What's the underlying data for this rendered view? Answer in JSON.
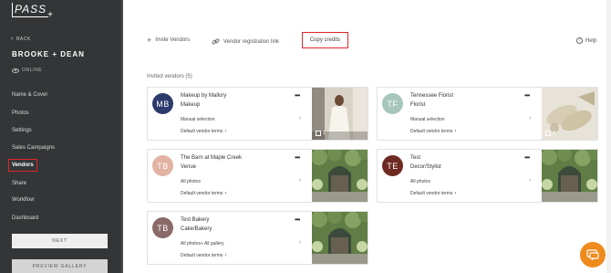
{
  "sidebar": {
    "logo": "PASS",
    "back": "BACK",
    "gallery_title": "BROOKE + DEAN",
    "status": "ONLINE",
    "items": [
      {
        "label": "Name & Cover"
      },
      {
        "label": "Photos"
      },
      {
        "label": "Settings"
      },
      {
        "label": "Sales Campaigns"
      },
      {
        "label": "Vendors"
      },
      {
        "label": "Share"
      },
      {
        "label": "Workflow"
      },
      {
        "label": "Dashboard"
      }
    ],
    "next_label": "NEXT",
    "preview_label": "PREVIEW GALLERY"
  },
  "toolbar": {
    "invite_label": "Invite Vendors",
    "registration_label": "Vendor registration link",
    "copy_credits_label": "Copy credits",
    "help_label": "Help"
  },
  "section_title": "Invited vendors (5)",
  "vendors": [
    {
      "initials": "MB",
      "name": "Makeup by Mallory",
      "type": "Makeup",
      "selection": "Manual selection",
      "terms": "Default vendor terms",
      "count": "1",
      "avatar_color": "#2d3a6b"
    },
    {
      "initials": "TF",
      "name": "Tennessee Florist",
      "type": "Florist",
      "selection": "Manual selection",
      "terms": "Default vendor terms",
      "count": "4",
      "avatar_color": "#a8c7bc"
    },
    {
      "initials": "TB",
      "name": "The Barn at Maple Creek",
      "type": "Venue",
      "selection": "All photos",
      "terms": "Default vendor terms",
      "count": "",
      "avatar_color": "#e2b2a2"
    },
    {
      "initials": "TE",
      "name": "Test",
      "type": "Decor/Stylist",
      "selection": "All photos",
      "terms": "Default vendor terms",
      "count": "",
      "avatar_color": "#6e2a22"
    },
    {
      "initials": "TB",
      "name": "Test Bakery",
      "type": "Cake/Bakery",
      "selection": "All photos+ All gallery",
      "terms": "Default vendor terms",
      "count": "",
      "avatar_color": "#8a6a68"
    }
  ],
  "colors": {
    "sidebar_bg": "#333536",
    "highlight": "#e0262b",
    "chat_fab": "#ef8a1c"
  }
}
